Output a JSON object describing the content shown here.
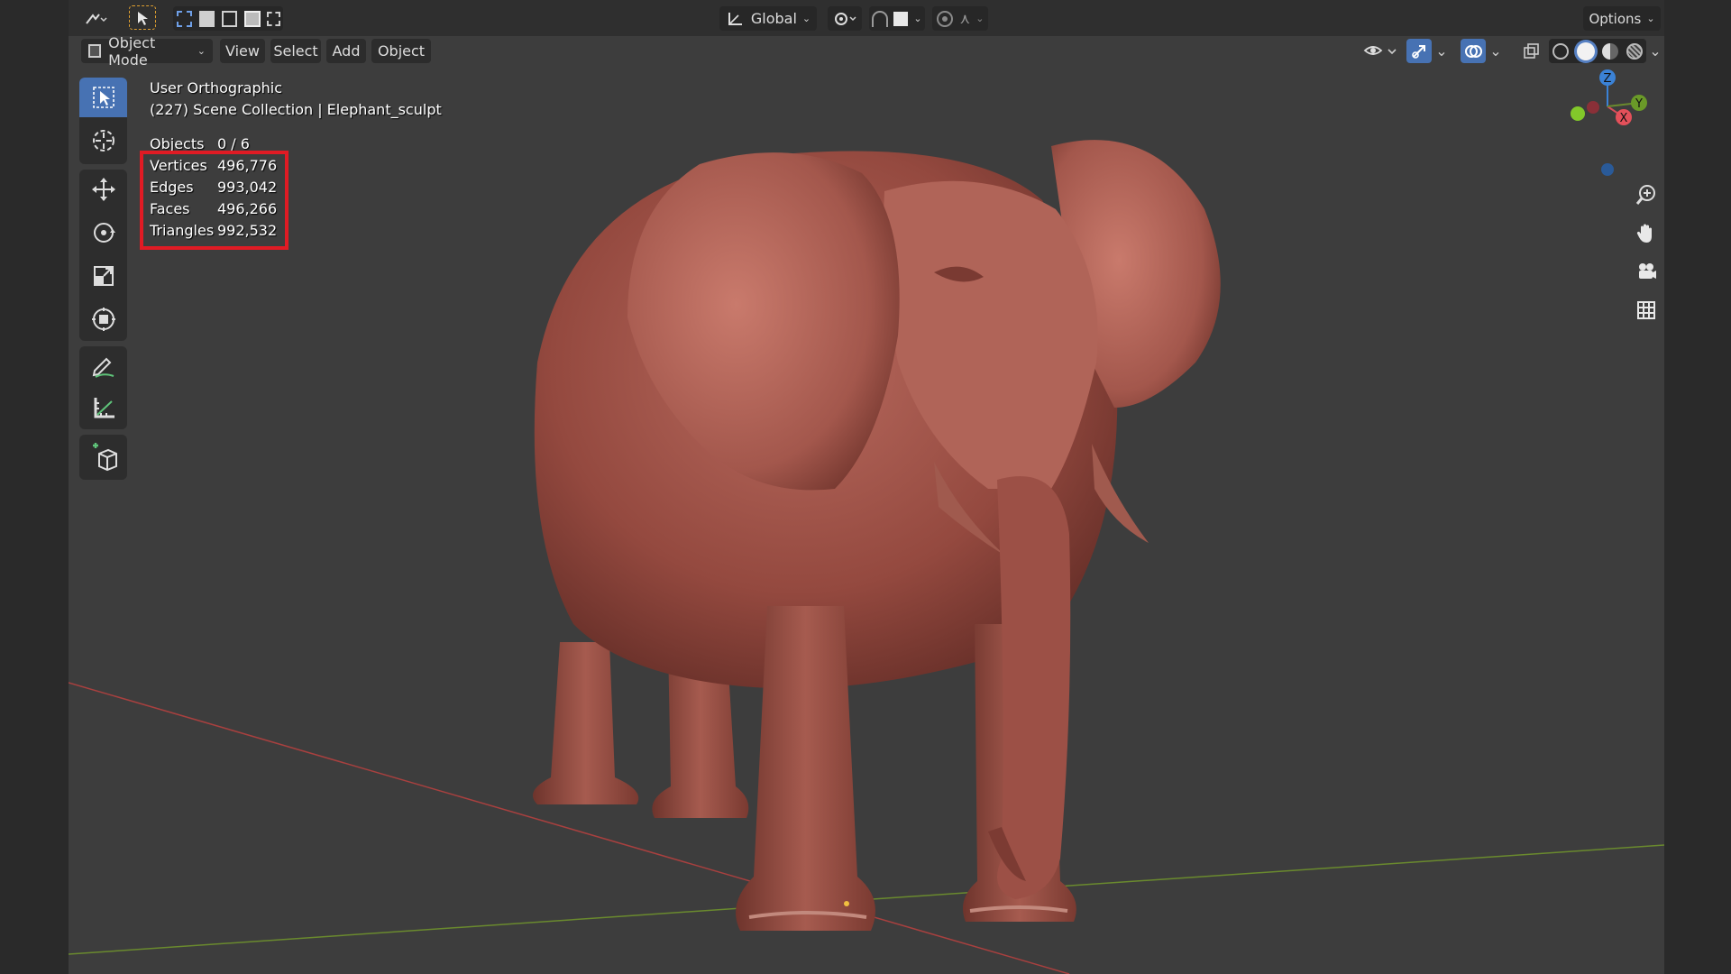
{
  "header": {
    "transform_orientation": "Global",
    "options_label": "Options",
    "mode_label": "Object Mode",
    "menus": [
      "View",
      "Select",
      "Add",
      "Object"
    ]
  },
  "viewport": {
    "view_name": "User Orthographic",
    "collection_line": "(227) Scene Collection | Elephant_sculpt"
  },
  "stats": {
    "objects_label": "Objects",
    "objects_value": "0 / 6",
    "vertices_label": "Vertices",
    "vertices_value": "496,776",
    "edges_label": "Edges",
    "edges_value": "993,042",
    "faces_label": "Faces",
    "faces_value": "496,266",
    "triangles_label": "Triangles",
    "triangles_value": "992,532"
  },
  "gizmo": {
    "z_label": "Z",
    "x_label": "X",
    "y_label": "Y"
  },
  "toolbar": {
    "tools": [
      "select-box",
      "cursor",
      "move",
      "rotate",
      "scale",
      "transform",
      "annotate",
      "measure",
      "add-cube"
    ]
  },
  "colors": {
    "accent": "#4772b3",
    "viewport_bg": "#3d3d3d",
    "highlight": "#e01b24",
    "sculpt": "#a0544a",
    "axis_x": "#a8403f",
    "axis_y": "#6a8a2e"
  }
}
